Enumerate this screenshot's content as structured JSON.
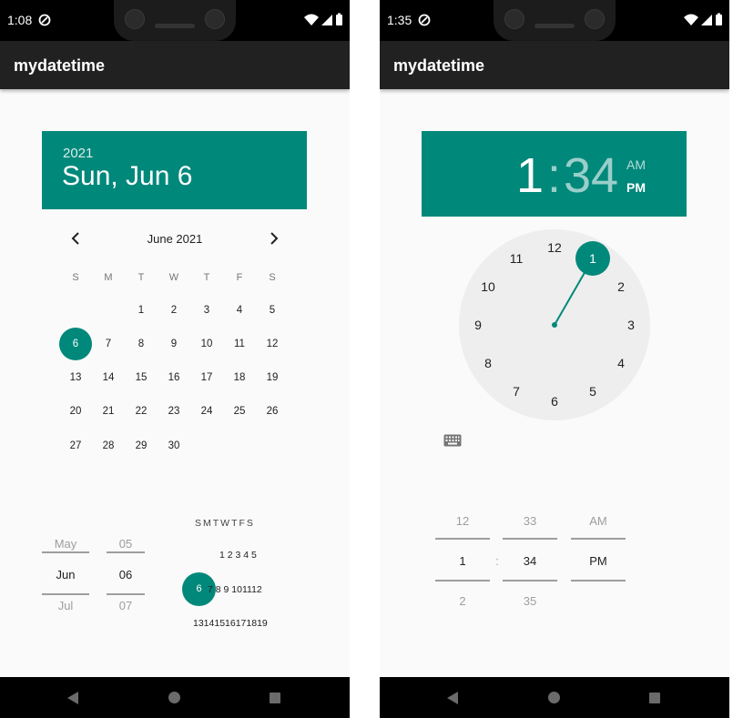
{
  "left": {
    "status": {
      "time": "1:08"
    },
    "app_title": "mydatetime",
    "date_header": {
      "year": "2021",
      "date": "Sun, Jun 6"
    },
    "calendar": {
      "month_label": "June 2021",
      "weekdays": [
        "S",
        "M",
        "T",
        "W",
        "T",
        "F",
        "S"
      ],
      "days": [
        "1",
        "2",
        "3",
        "4",
        "5",
        "6",
        "7",
        "8",
        "9",
        "10",
        "11",
        "12",
        "13",
        "14",
        "15",
        "16",
        "17",
        "18",
        "19",
        "20",
        "21",
        "22",
        "23",
        "24",
        "25",
        "26",
        "27",
        "28",
        "29",
        "30"
      ],
      "selected": "6"
    },
    "date_spinner": {
      "month": {
        "prev": "May",
        "current": "Jun",
        "next": "Jul"
      },
      "day": {
        "prev": "05",
        "current": "06",
        "next": "07"
      }
    },
    "mini_calendar": {
      "weekdays": "SMTWTFS",
      "row1": "1 2 3 4 5",
      "row2_selected": "6",
      "row2_rest": "7 8 9 101112",
      "row3": "13141516171819"
    }
  },
  "right": {
    "status": {
      "time": "1:35"
    },
    "app_title": "mydatetime",
    "time_header": {
      "hour": "1",
      "colon": ":",
      "minute": "34",
      "am": "AM",
      "pm": "PM"
    },
    "clock": {
      "numbers": [
        "12",
        "1",
        "2",
        "3",
        "4",
        "5",
        "6",
        "7",
        "8",
        "9",
        "10",
        "11"
      ],
      "selected_hour": "1"
    },
    "time_spinner": {
      "hour": {
        "prev": "12",
        "current": "1",
        "next": "2"
      },
      "separator": ":",
      "minute": {
        "prev": "33",
        "current": "34",
        "next": "35"
      },
      "ampm": {
        "prev": "AM",
        "current": "PM"
      }
    }
  },
  "colors": {
    "accent": "#00887a",
    "appbar": "#212121",
    "background": "#fafafa",
    "clock_face": "#eeeeee"
  },
  "icons": [
    "sync-icon",
    "wifi-icon",
    "signal-icon",
    "battery-icon",
    "chevron-left-icon",
    "chevron-right-icon",
    "keyboard-icon",
    "back-icon",
    "home-icon",
    "recents-icon"
  ]
}
